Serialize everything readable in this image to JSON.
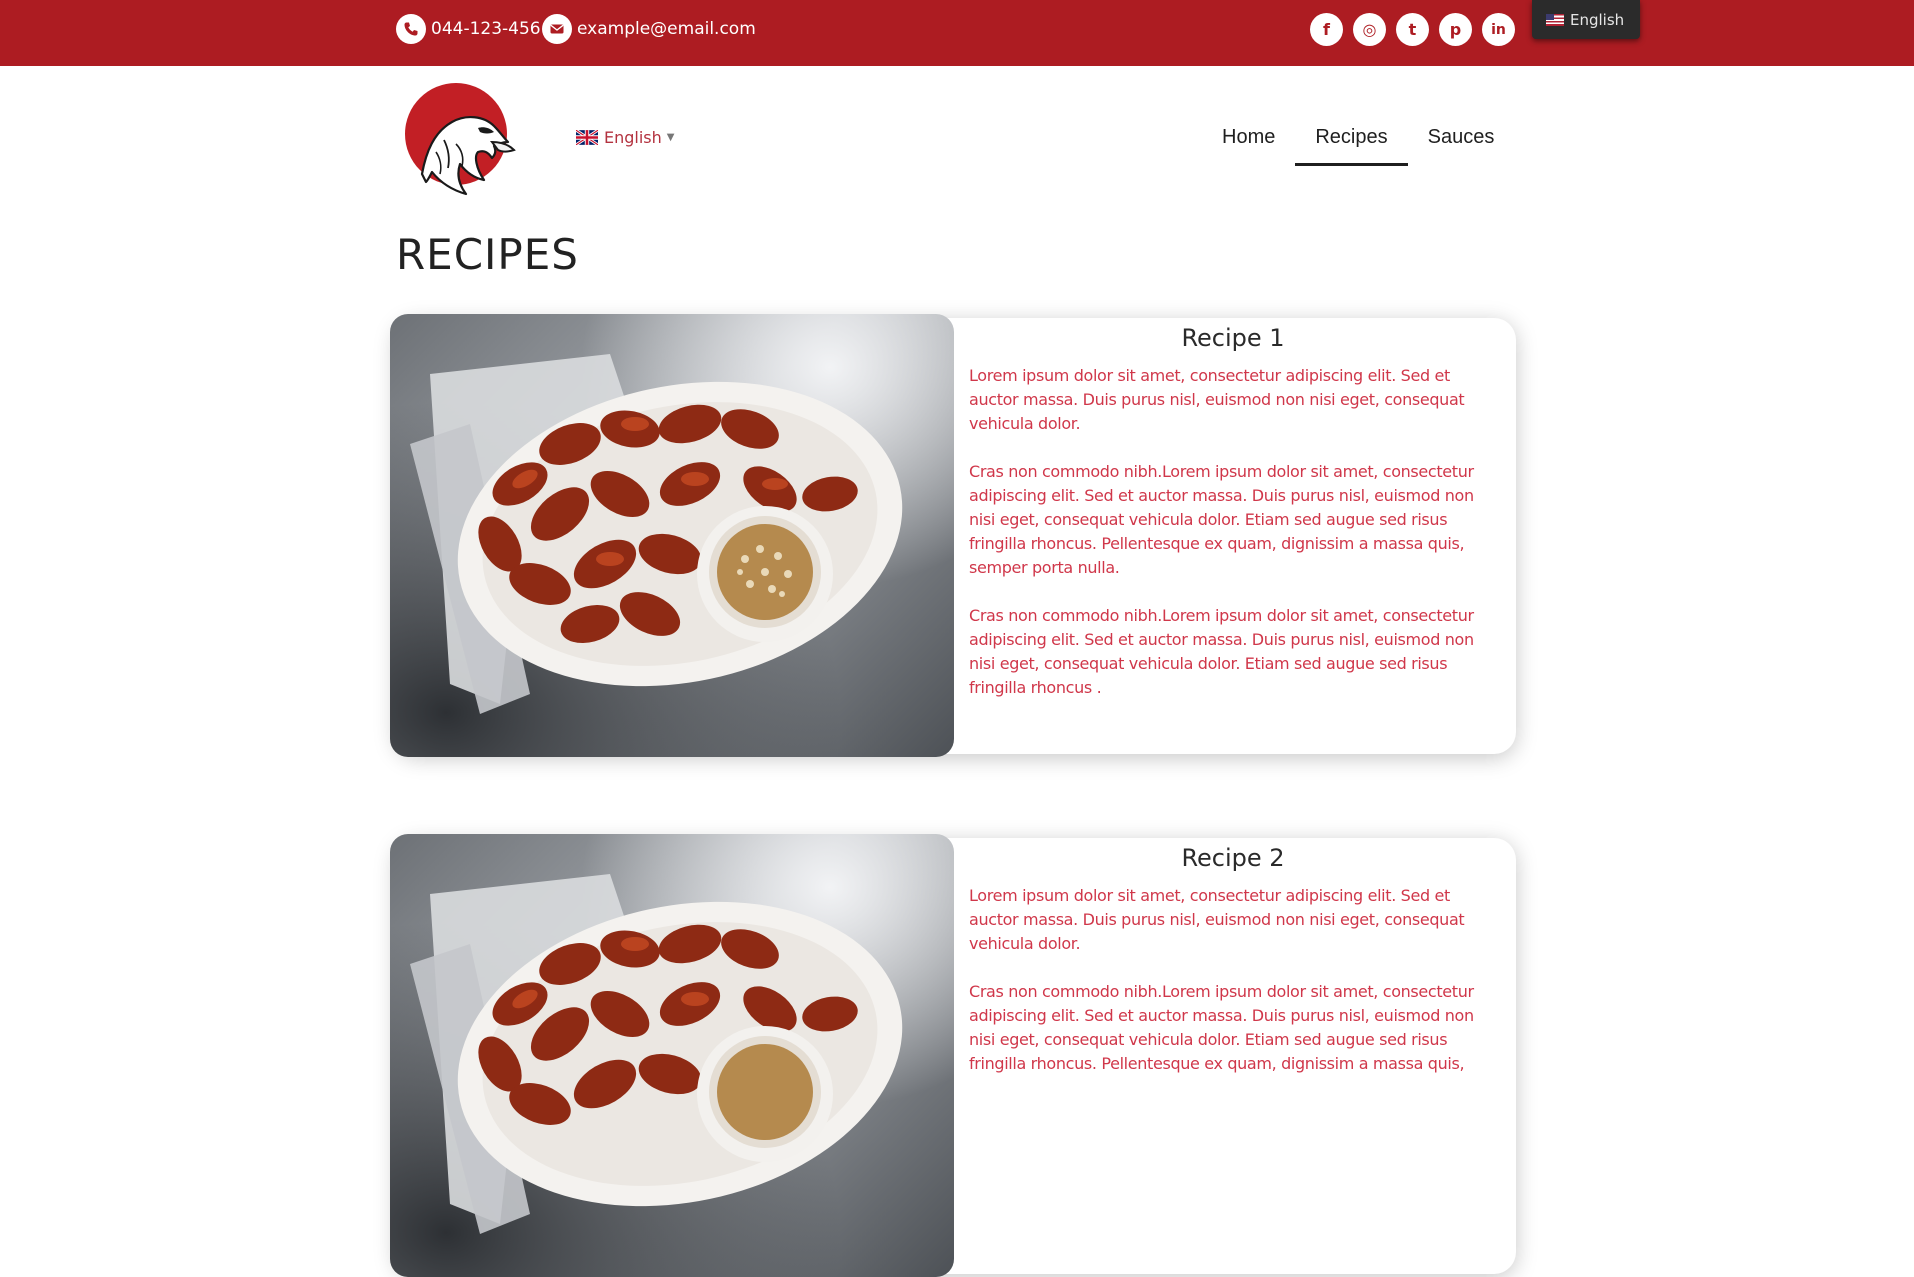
{
  "topbar": {
    "phone": "044-123-456",
    "email": "example@email.com",
    "socials": [
      {
        "icon": "facebook-icon",
        "glyph": "f"
      },
      {
        "icon": "instagram-icon",
        "glyph": "◎"
      },
      {
        "icon": "twitter-icon",
        "glyph": "t"
      },
      {
        "icon": "pinterest-icon",
        "glyph": "p"
      },
      {
        "icon": "linkedin-icon",
        "glyph": "in"
      }
    ],
    "language_badge": "English"
  },
  "header": {
    "logo": "eagle-logo",
    "language_select": "English",
    "nav": [
      {
        "label": "Home",
        "active": false
      },
      {
        "label": "Recipes",
        "active": true
      },
      {
        "label": "Sauces",
        "active": false
      }
    ]
  },
  "page_title": "RECIPES",
  "recipes": [
    {
      "title": "Recipe 1",
      "paragraphs": [
        "Lorem ipsum dolor sit amet, consectetur adipiscing elit. Sed et auctor massa. Duis purus nisl, euismod non nisi eget, consequat vehicula dolor.",
        "Cras non commodo nibh.Lorem ipsum dolor sit amet, consectetur adipiscing elit. Sed et auctor massa. Duis purus nisl, euismod non nisi eget, consequat vehicula dolor. Etiam sed augue sed risus fringilla rhoncus. Pellentesque ex quam, dignissim a massa quis, semper porta nulla.",
        "Cras non commodo nibh.Lorem ipsum dolor sit amet, consectetur adipiscing elit. Sed et auctor massa. Duis purus nisl, euismod non nisi eget, consequat vehicula dolor. Etiam sed augue sed risus fringilla rhoncus ."
      ]
    },
    {
      "title": "Recipe 2",
      "paragraphs": [
        "Lorem ipsum dolor sit amet, consectetur adipiscing elit. Sed et auctor massa. Duis purus nisl, euismod non nisi eget, consequat vehicula dolor.",
        "Cras non commodo nibh.Lorem ipsum dolor sit amet, consectetur adipiscing elit. Sed et auctor massa. Duis purus nisl, euismod non nisi eget, consequat vehicula dolor. Etiam sed augue sed risus fringilla rhoncus. Pellentesque ex quam, dignissim a massa quis,"
      ]
    }
  ],
  "colors": {
    "brand_red": "#ad1c22",
    "body_text_red": "#d0374a",
    "heading_dark": "#222222"
  }
}
